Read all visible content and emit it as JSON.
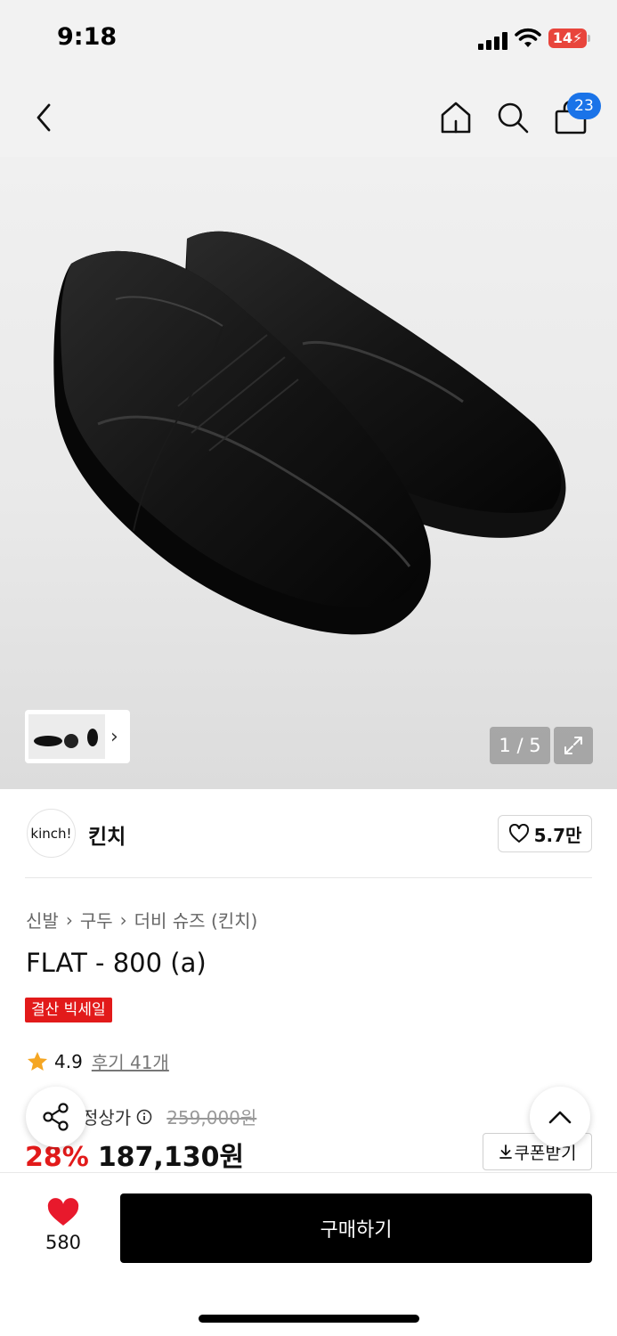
{
  "status_bar": {
    "time": "9:18",
    "battery": "14"
  },
  "nav": {
    "cart_count": "23",
    "icons": [
      "back-chevron-icon",
      "home-icon",
      "search-icon",
      "bag-icon"
    ]
  },
  "gallery": {
    "counter": "1 / 5"
  },
  "brand": {
    "logo_text": "kinch!",
    "name": "킨치",
    "likes": "5.7만"
  },
  "product": {
    "breadcrumb": [
      "신발",
      "구두",
      "더비 슈즈 (킨치)"
    ],
    "title": "FLAT - 800 (a)",
    "badge": "결산 빅세일",
    "rating": "4.9",
    "reviews": "후기 41개",
    "price_label": "정상가",
    "original_price": "259,000원",
    "discount": "28%",
    "sale_price": "187,130원",
    "coupon_label": "쿠폰받기"
  },
  "bottom": {
    "wish_count": "580",
    "buy_label": "구매하기"
  },
  "colors": {
    "sale_red": "#e21a1a",
    "badge_blue": "#1a73e8",
    "star": "#f5a623",
    "heart": "#e8192c"
  }
}
